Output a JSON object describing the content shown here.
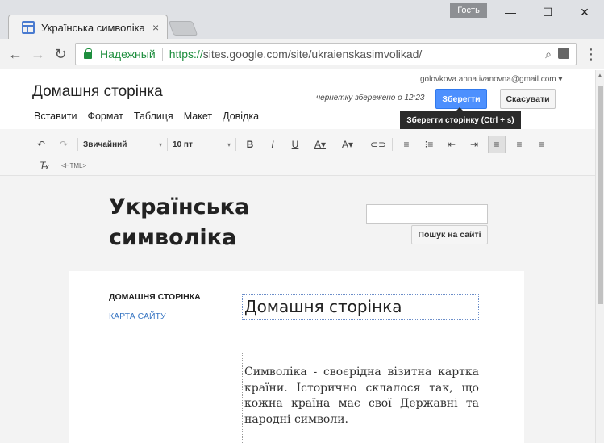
{
  "window": {
    "tab_title": "Українська символіка",
    "guest_label": "Гость",
    "close_tab": "×",
    "minimize": "—",
    "maximize": "☐",
    "close": "✕"
  },
  "toolbar": {
    "back": "←",
    "forward": "→",
    "reload": "↻",
    "secure_label": "Надежный",
    "url_proto": "https://",
    "url_rest": "sites.google.com/site/ukraienskasimvolikad/",
    "zoom_icon": "⌕",
    "menu": "⋮"
  },
  "header": {
    "page_title": "Домашня сторінка",
    "user_email": "golovkova.anna.ivanovna@gmail.com ▾",
    "saved_text": "чернетку збережено о 12:23",
    "save_label": "Зберегти",
    "cancel_label": "Скасувати",
    "tooltip": "Зберегти сторінку (Ctrl + s)",
    "menu": [
      "Вставити",
      "Формат",
      "Таблиця",
      "Макет",
      "Довідка"
    ]
  },
  "format": {
    "style_select": "Звичайний",
    "size_select": "10 пт",
    "html_label": "<HTML>"
  },
  "site": {
    "title_line1": "Українська",
    "title_line2": "символіка",
    "search_button": "Пошук на сайті",
    "nav_home": "ДОМАШНЯ СТОРІНКА",
    "nav_map": "КАРТА САЙТУ",
    "heading": "Домашня сторінка",
    "body_text": "Символіка - своєрідна візитна картка країни. Історично склалося так, що кожна країна має свої Державні та народні символи."
  }
}
